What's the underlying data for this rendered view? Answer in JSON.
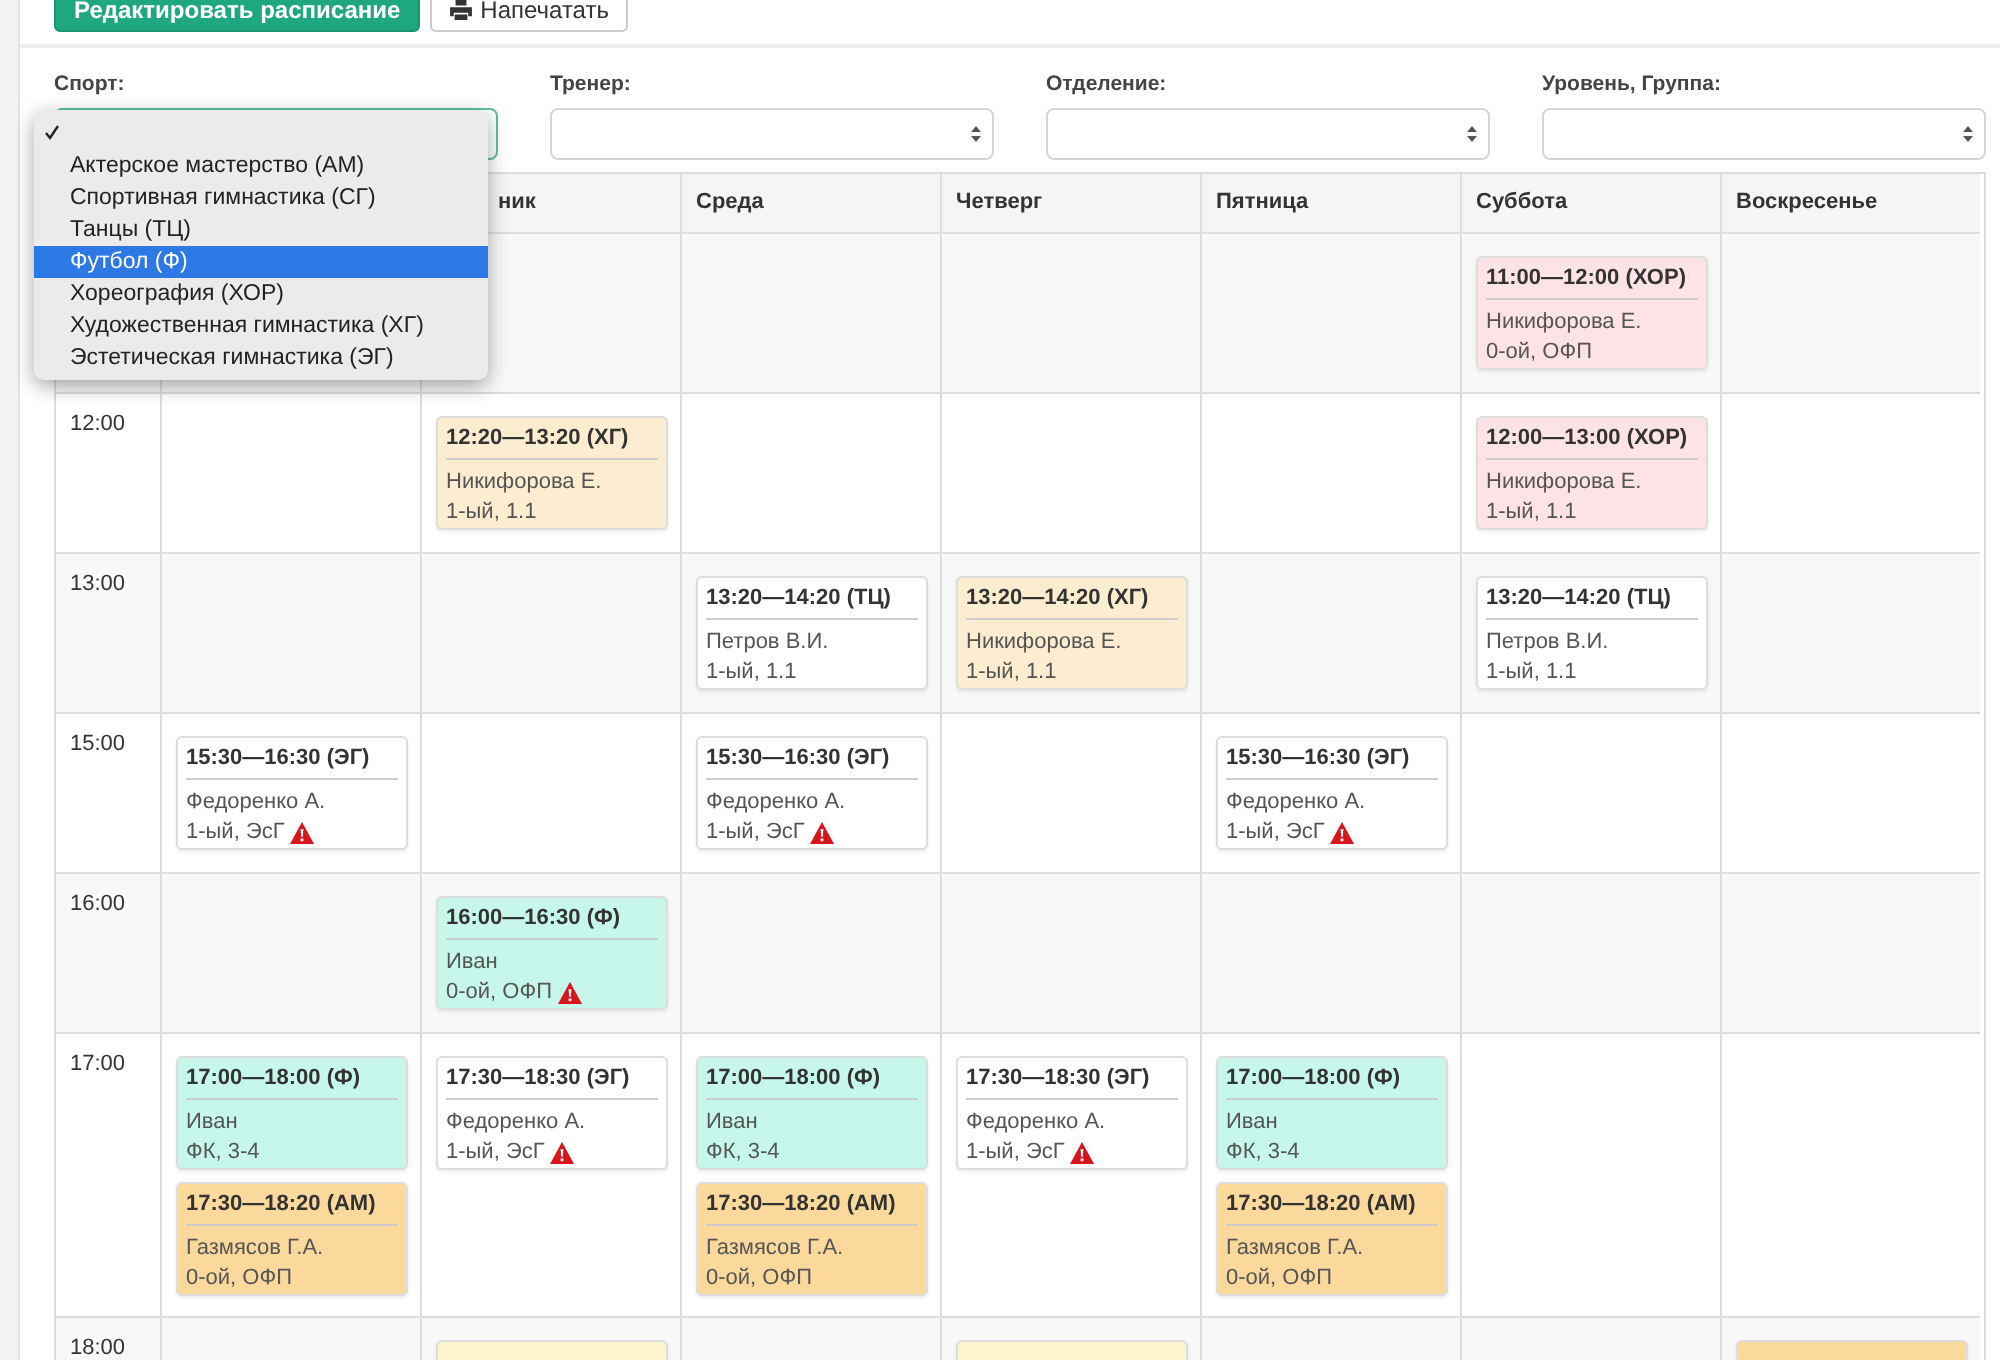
{
  "toolbar": {
    "buttons": [
      {
        "label": "Редактировать расписание",
        "kind": "primary"
      },
      {
        "label": "Напечатать",
        "kind": "print"
      }
    ]
  },
  "filters": [
    {
      "label": "Спорт:",
      "expanded": true,
      "options": [
        {
          "checked": true,
          "selected": false
        },
        {
          "label": "Актерское мастерство (АМ)",
          "checked": false,
          "selected": false
        },
        {
          "label": "Спортивная гимнастика (СГ)",
          "checked": false,
          "selected": false
        },
        {
          "label": "Танцы (ТЦ)",
          "checked": false,
          "selected": false
        },
        {
          "label": "Футбол (Ф)",
          "checked": false,
          "selected": true
        },
        {
          "label": "Хореография (ХОР)",
          "checked": false,
          "selected": false
        },
        {
          "label": "Художественная гимнастика (ХГ)",
          "checked": false,
          "selected": false
        },
        {
          "label": "Эстетическая гимнастика (ЭГ)",
          "checked": false,
          "selected": false
        }
      ]
    },
    {
      "label": "Тренер:",
      "expanded": false
    },
    {
      "label": "Отделение:",
      "expanded": false
    },
    {
      "label": "Уровень, Группа:",
      "expanded": false
    }
  ],
  "table": {
    "columns": [
      {},
      {
        "label": "ник"
      },
      {
        "label": "Среда"
      },
      {
        "label": "Четверг"
      },
      {
        "label": "Пятница"
      },
      {
        "label": "Суббота"
      },
      {
        "label": "Воскресенье"
      }
    ],
    "rows": [
      {
        "cells": [
          [],
          [],
          [],
          [],
          [],
          [
            {
              "time": "11:00—12:00 (ХОР)",
              "coach": "Никифорова Е.",
              "group": "0-ой, ОФП",
              "warning": false,
              "color": "#fde3e6"
            }
          ],
          []
        ]
      },
      {
        "time": "12:00",
        "cells": [
          [],
          [
            {
              "time": "12:20—13:20 (ХГ)",
              "coach": "Никифорова Е.",
              "group": "1-ый, 1.1",
              "warning": false,
              "color": "#fdedd0"
            }
          ],
          [],
          [],
          [],
          [
            {
              "time": "12:00—13:00 (ХОР)",
              "coach": "Никифорова Е.",
              "group": "1-ый, 1.1",
              "warning": false,
              "color": "#fde3e6"
            }
          ],
          []
        ]
      },
      {
        "time": "13:00",
        "cells": [
          [],
          [],
          [
            {
              "time": "13:20—14:20 (ТЦ)",
              "coach": "Петров В.И.",
              "group": "1-ый, 1.1",
              "warning": false,
              "color": "#ffffff"
            }
          ],
          [
            {
              "time": "13:20—14:20 (ХГ)",
              "coach": "Никифорова Е.",
              "group": "1-ый, 1.1",
              "warning": false,
              "color": "#fdedd0"
            }
          ],
          [],
          [
            {
              "time": "13:20—14:20 (ТЦ)",
              "coach": "Петров В.И.",
              "group": "1-ый, 1.1",
              "warning": false,
              "color": "#ffffff"
            }
          ],
          []
        ]
      },
      {
        "time": "15:00",
        "cells": [
          [
            {
              "time": "15:30—16:30 (ЭГ)",
              "coach": "Федоренко А.",
              "group": "1-ый, ЭсГ",
              "warning": true,
              "color": "#ffffff"
            }
          ],
          [],
          [
            {
              "time": "15:30—16:30 (ЭГ)",
              "coach": "Федоренко А.",
              "group": "1-ый, ЭсГ",
              "warning": true,
              "color": "#ffffff"
            }
          ],
          [],
          [
            {
              "time": "15:30—16:30 (ЭГ)",
              "coach": "Федоренко А.",
              "group": "1-ый, ЭсГ",
              "warning": true,
              "color": "#ffffff"
            }
          ],
          [],
          []
        ]
      },
      {
        "time": "16:00",
        "cells": [
          [],
          [
            {
              "time": "16:00—16:30 (Ф)",
              "coach": "Иван",
              "group": "0-ой, ОФП",
              "warning": true,
              "color": "#c6f7ea"
            }
          ],
          [],
          [],
          [],
          [],
          []
        ]
      },
      {
        "time": "17:00",
        "cells": [
          [
            {
              "time": "17:00—18:00 (Ф)",
              "coach": "Иван",
              "group": "ФК, 3-4",
              "warning": false,
              "color": "#c6f7ea"
            },
            {
              "time": "17:30—18:20 (АМ)",
              "coach": "Газмясов Г.А.",
              "group": "0-ой, ОФП",
              "warning": false,
              "color": "#fbd99d"
            }
          ],
          [
            {
              "time": "17:30—18:30 (ЭГ)",
              "coach": "Федоренко А.",
              "group": "1-ый, ЭсГ",
              "warning": true,
              "color": "#ffffff"
            }
          ],
          [
            {
              "time": "17:00—18:00 (Ф)",
              "coach": "Иван",
              "group": "ФК, 3-4",
              "warning": false,
              "color": "#c6f7ea"
            },
            {
              "time": "17:30—18:20 (АМ)",
              "coach": "Газмясов Г.А.",
              "group": "0-ой, ОФП",
              "warning": false,
              "color": "#fbd99d"
            }
          ],
          [
            {
              "time": "17:30—18:30 (ЭГ)",
              "coach": "Федоренко А.",
              "group": "1-ый, ЭсГ",
              "warning": true,
              "color": "#ffffff"
            }
          ],
          [
            {
              "time": "17:00—18:00 (Ф)",
              "coach": "Иван",
              "group": "ФК, 3-4",
              "warning": false,
              "color": "#c6f7ea"
            },
            {
              "time": "17:30—18:20 (АМ)",
              "coach": "Газмясов Г.А.",
              "group": "0-ой, ОФП",
              "warning": false,
              "color": "#fbd99d"
            }
          ],
          [],
          []
        ]
      },
      {
        "time": "18:00",
        "cells": [
          [],
          [
            {
              "color": "#fdf5cf"
            }
          ],
          [],
          [
            {
              "color": "#fdf5cf"
            }
          ],
          [],
          [],
          [
            {
              "color": "#fbd99d"
            }
          ]
        ]
      }
    ]
  }
}
